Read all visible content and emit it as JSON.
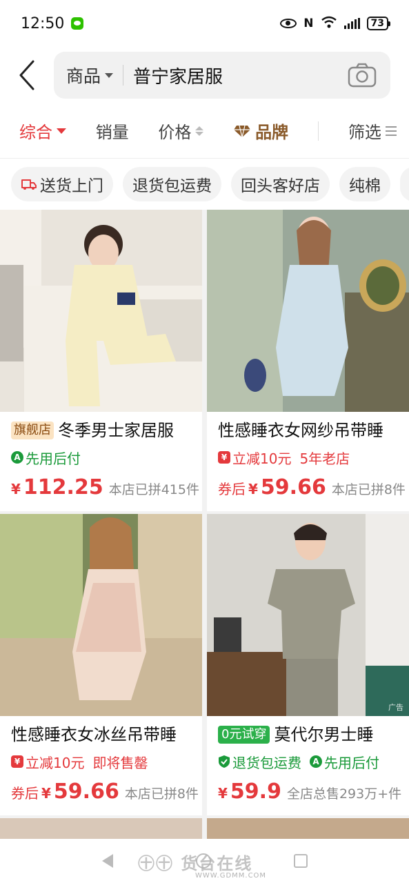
{
  "status_bar": {
    "time": "12:50",
    "battery": "73"
  },
  "header": {
    "scope": "商品",
    "query": "普宁家居服"
  },
  "sort_tabs": [
    {
      "label": "综合",
      "active": true
    },
    {
      "label": "销量"
    },
    {
      "label": "价格"
    },
    {
      "label": "品牌"
    },
    {
      "label": "筛选"
    }
  ],
  "chips": [
    "送货上门",
    "退货包运费",
    "回头客好店",
    "纯棉"
  ],
  "products": [
    {
      "badge": "旗舰店",
      "title": "冬季男士家居服",
      "tags": [
        {
          "text": "先用后付",
          "color": "green"
        }
      ],
      "coupon": "",
      "price": "112.25",
      "sales": "本店已拼415件"
    },
    {
      "badge": "",
      "title": "性感睡衣女网纱吊带睡",
      "tags": [
        {
          "text": "立减10元",
          "color": "red"
        },
        {
          "text": "5年老店",
          "color": "red"
        }
      ],
      "coupon": "券后",
      "price": "59.66",
      "sales": "本店已拼8件"
    },
    {
      "badge": "",
      "title": "性感睡衣女冰丝吊带睡",
      "tags": [
        {
          "text": "立减10元",
          "color": "red"
        },
        {
          "text": "即将售罄",
          "color": "red"
        }
      ],
      "coupon": "券后",
      "price": "59.66",
      "sales": "本店已拼8件"
    },
    {
      "badge": "0元试穿",
      "title": "莫代尔男士睡",
      "tags": [
        {
          "text": "退货包运费",
          "color": "green"
        },
        {
          "text": "先用后付",
          "color": "green"
        }
      ],
      "coupon": "",
      "price": "59.9",
      "sales": "全店总售293万+件",
      "ad_label": "广告"
    }
  ],
  "watermark": {
    "text": "㊉㊉ 货台在线",
    "sub": "WWW.GDMM.COM"
  },
  "colors": {
    "accent": "#e4393c",
    "brand": "#8a5a2a",
    "green": "#1a9a3a"
  },
  "currency": "¥"
}
